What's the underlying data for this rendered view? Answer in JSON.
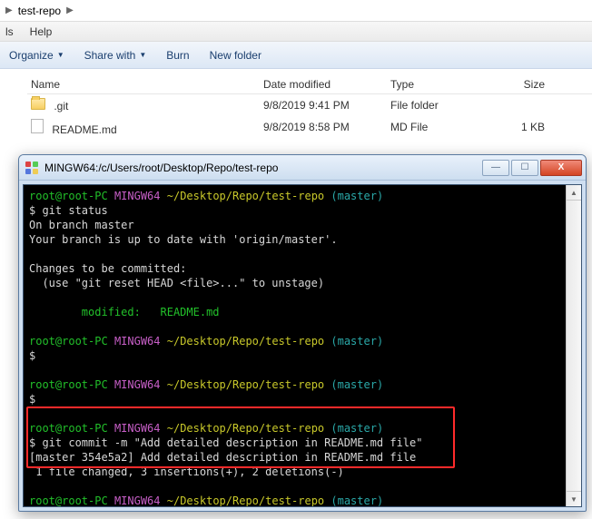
{
  "breadcrumb": {
    "current": "test-repo"
  },
  "menu": {
    "left": "ls",
    "help": "Help"
  },
  "toolbar": {
    "organize": "Organize",
    "share": "Share with",
    "burn": "Burn",
    "newfolder": "New folder"
  },
  "columns": {
    "name": "Name",
    "date": "Date modified",
    "type": "Type",
    "size": "Size"
  },
  "files": [
    {
      "name": ".git",
      "date": "9/8/2019 9:41 PM",
      "type": "File folder",
      "size": "",
      "icon": "folder"
    },
    {
      "name": "README.md",
      "date": "9/8/2019 8:58 PM",
      "type": "MD File",
      "size": "1 KB",
      "icon": "file"
    }
  ],
  "term": {
    "title": "MINGW64:/c/Users/root/Desktop/Repo/test-repo",
    "winbtns": {
      "min": "—",
      "max": "☐",
      "close": "X"
    },
    "prompt_user": "root@root-PC",
    "prompt_os": "MINGW64",
    "prompt_path": "~/Desktop/Repo/test-repo",
    "prompt_branch": "(master)",
    "cmd_status": "$ git status",
    "l_onbranch": "On branch master",
    "l_uptodate": "Your branch is up to date with 'origin/master'.",
    "l_changes": "Changes to be committed:",
    "l_unstage": "  (use \"git reset HEAD <file>...\" to unstage)",
    "l_modified": "        modified:   README.md",
    "dollar": "$",
    "cmd_commit": "$ git commit -m \"Add detailed description in README.md file\"",
    "l_commitres": "[master 354e5a2] Add detailed description in README.md file",
    "l_commitstat": " 1 file changed, 3 insertions(+), 2 deletions(-)"
  }
}
